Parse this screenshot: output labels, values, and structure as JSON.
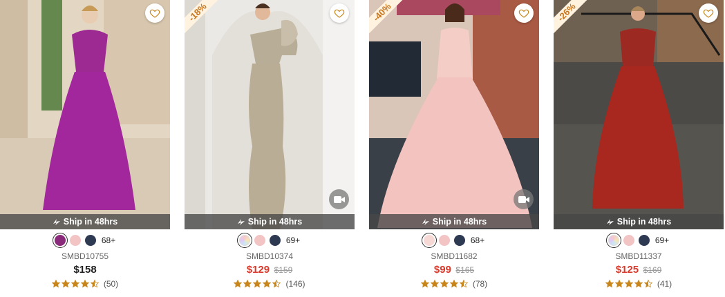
{
  "products": [
    {
      "sku": "SMBD10755",
      "price": "$158",
      "original_price": "",
      "on_sale": false,
      "discount": "",
      "ship_label": "Ship in 48hrs",
      "more_colors": "68+",
      "swatch_colors": [
        "#8a2a7a",
        "#f2c4c4",
        "#2d3a52"
      ],
      "selected_swatch": 0,
      "rating": 4.5,
      "review_count": "(50)",
      "has_video": false,
      "dress_color": "#a2269c"
    },
    {
      "sku": "SMBD10374",
      "price": "$129",
      "original_price": "$159",
      "on_sale": true,
      "discount": "-18%",
      "ship_label": "Ship in 48hrs",
      "more_colors": "69+",
      "swatch_colors": [
        "multicolor",
        "#f2c4c4",
        "#2d3a52"
      ],
      "selected_swatch": 0,
      "rating": 4.5,
      "review_count": "(146)",
      "has_video": true,
      "dress_color": "#b9ad95"
    },
    {
      "sku": "SMBD11682",
      "price": "$99",
      "original_price": "$165",
      "on_sale": true,
      "discount": "-40%",
      "ship_label": "Ship in 48hrs",
      "more_colors": "68+",
      "swatch_colors": [
        "#f6d9d5",
        "#f2c4c4",
        "#2d3a52"
      ],
      "selected_swatch": 0,
      "rating": 4.5,
      "review_count": "(78)",
      "has_video": true,
      "dress_color": "#f3c3bf"
    },
    {
      "sku": "SMBD11337",
      "price": "$125",
      "original_price": "$169",
      "on_sale": true,
      "discount": "-26%",
      "ship_label": "Ship in 48hrs",
      "more_colors": "69+",
      "swatch_colors": [
        "multicolor",
        "#f2c4c4",
        "#2d3a52"
      ],
      "selected_swatch": 0,
      "rating": 4.5,
      "review_count": "(41)",
      "has_video": false,
      "dress_color": "#a8281f"
    }
  ],
  "colors": {
    "sale_price": "#d83a2c",
    "star": "#c8861a",
    "discount_text": "#c8731a"
  },
  "icons": {
    "favorite": "heart-outline-icon",
    "video": "video-camera-icon",
    "shipping": "fast-shipping-icon",
    "rating": "star-icon"
  }
}
